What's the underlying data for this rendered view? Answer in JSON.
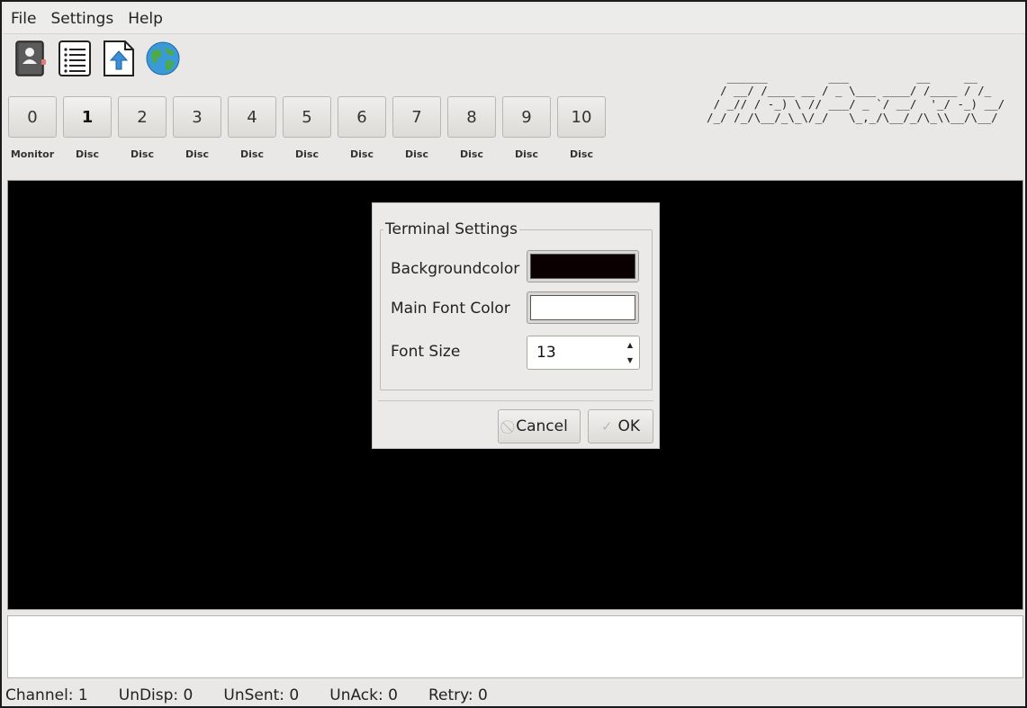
{
  "menu": [
    "File",
    "Settings",
    "Help"
  ],
  "toolbar": {
    "icons": [
      "address-book-icon",
      "document-list-icon",
      "upload-icon",
      "globe-icon"
    ]
  },
  "channels": [
    {
      "number": "0",
      "label": "Monitor",
      "active": false
    },
    {
      "number": "1",
      "label": "Disc",
      "active": true
    },
    {
      "number": "2",
      "label": "Disc",
      "active": false
    },
    {
      "number": "3",
      "label": "Disc",
      "active": false
    },
    {
      "number": "4",
      "label": "Disc",
      "active": false
    },
    {
      "number": "5",
      "label": "Disc",
      "active": false
    },
    {
      "number": "6",
      "label": "Disc",
      "active": false
    },
    {
      "number": "7",
      "label": "Disc",
      "active": false
    },
    {
      "number": "8",
      "label": "Disc",
      "active": false
    },
    {
      "number": "9",
      "label": "Disc",
      "active": false
    },
    {
      "number": "10",
      "label": "Disc",
      "active": false
    }
  ],
  "logo_ascii": "     ______         ___          __     __\n    / __/ /____ __ / _ \\___ ____/ /____ / /_\n   / _// / -_) \\ // ___/ _ `/ __/  '_/ -_) __/\n  /_/ /_/\\__/_\\_\\/_/   \\_,_/\\__/_/\\_\\\\__/\\__/",
  "dialog": {
    "group_title": "Terminal Settings",
    "background_label": "Backgroundcolor",
    "background_color": "#0a0002",
    "font_color_label": "Main Font Color",
    "font_color": "#ffffff",
    "font_size_label": "Font Size",
    "font_size_value": "13",
    "cancel_label": "Cancel",
    "ok_label": "OK"
  },
  "status": {
    "channel": "Channel: 1",
    "undisp": "UnDisp: 0",
    "unsent": "UnSent: 0",
    "unack": "UnAck: 0",
    "retry": "Retry: 0"
  }
}
